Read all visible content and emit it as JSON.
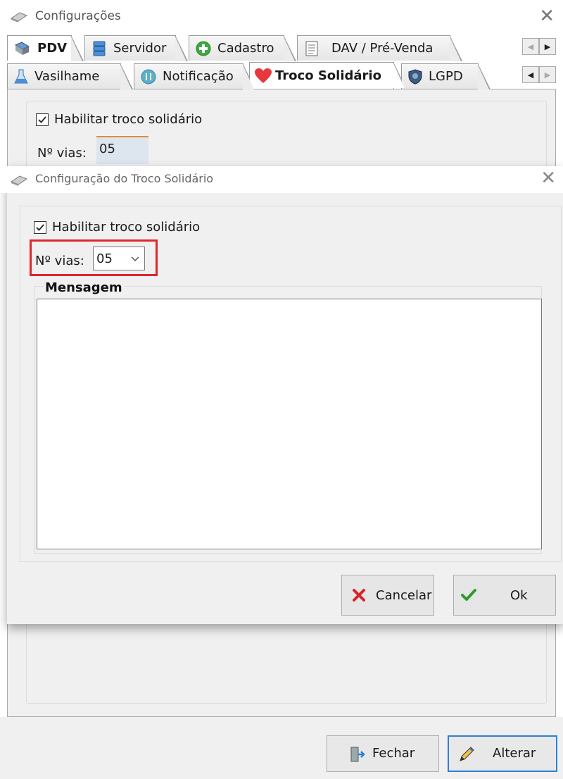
{
  "main_window": {
    "title": "Configurações",
    "tabs_row1": [
      {
        "label": "PDV",
        "icon": "pdv-icon",
        "active": true
      },
      {
        "label": "Servidor",
        "icon": "server-icon",
        "active": false
      },
      {
        "label": "Cadastro",
        "icon": "add-circle-icon",
        "active": false
      },
      {
        "label": "DAV / Pré-Venda",
        "icon": "document-icon",
        "active": false
      }
    ],
    "tabs_row2": [
      {
        "label": "Vasilhame",
        "icon": "flask-icon",
        "active": false
      },
      {
        "label": "Notificação",
        "icon": "notification-icon",
        "active": false
      },
      {
        "label": "Troco Solidário",
        "icon": "heart-icon",
        "active": true
      },
      {
        "label": "LGPD",
        "icon": "shield-icon",
        "active": false
      }
    ],
    "enable_label": "Habilitar troco solidário",
    "enable_checked": true,
    "vias_label": "Nº vias:",
    "vias_value": "05",
    "buttons": {
      "close_label": "Fechar",
      "edit_label": "Alterar"
    }
  },
  "dialog": {
    "title": "Configuração do Troco Solidário",
    "enable_label": "Habilitar troco solidário",
    "enable_checked": true,
    "vias_label": "Nº vias:",
    "vias_value": "05",
    "message_legend": "Mensagem",
    "message_value": "",
    "buttons": {
      "cancel_label": "Cancelar",
      "ok_label": "Ok"
    }
  },
  "colors": {
    "highlight": "#e0252f",
    "accent_blue": "#2f7fd6",
    "cancel_red": "#d8232a",
    "ok_green": "#2e9b2e",
    "heart_red": "#e8383d"
  }
}
